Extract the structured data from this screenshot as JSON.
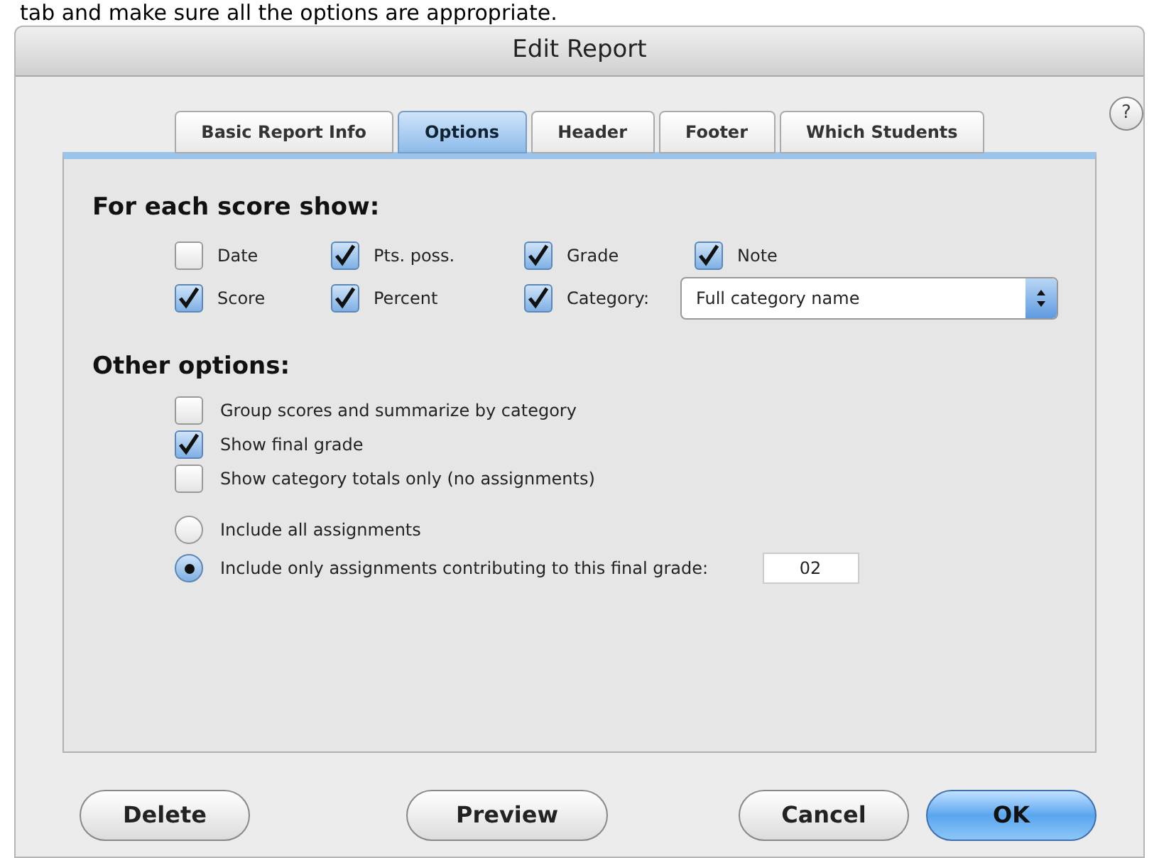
{
  "caption": "tab and make sure all the options are appropriate.",
  "window": {
    "title": "Edit Report"
  },
  "tabs": [
    {
      "label": "Basic Report Info",
      "selected": false
    },
    {
      "label": "Options",
      "selected": true
    },
    {
      "label": "Header",
      "selected": false
    },
    {
      "label": "Footer",
      "selected": false
    },
    {
      "label": "Which Students",
      "selected": false
    }
  ],
  "help_button": {
    "label": "?"
  },
  "score_options": {
    "heading": "For each score show:",
    "rows": [
      [
        {
          "label": "Date",
          "checked": false
        },
        {
          "label": "Pts. poss.",
          "checked": true
        },
        {
          "label": "Grade",
          "checked": true
        },
        {
          "label": "Note",
          "checked": true
        }
      ],
      [
        {
          "label": "Score",
          "checked": true
        },
        {
          "label": "Percent",
          "checked": true
        },
        {
          "label": "Category:",
          "checked": true
        }
      ]
    ],
    "category_select": {
      "value": "Full category name"
    }
  },
  "other_options": {
    "heading": "Other options:",
    "checkboxes": [
      {
        "label": "Group scores and summarize by category",
        "checked": false
      },
      {
        "label": "Show final grade",
        "checked": true
      },
      {
        "label": "Show category totals only (no assignments)",
        "checked": false
      }
    ],
    "radios": [
      {
        "label": "Include all assignments",
        "selected": false
      },
      {
        "label": "Include only assignments contributing to this final grade:",
        "selected": true
      }
    ],
    "grade_field": {
      "value": "02"
    }
  },
  "buttons": [
    {
      "label": "Delete",
      "default": false
    },
    {
      "label": "Preview",
      "default": false
    },
    {
      "label": "Cancel",
      "default": false
    },
    {
      "label": "OK",
      "default": true
    }
  ]
}
